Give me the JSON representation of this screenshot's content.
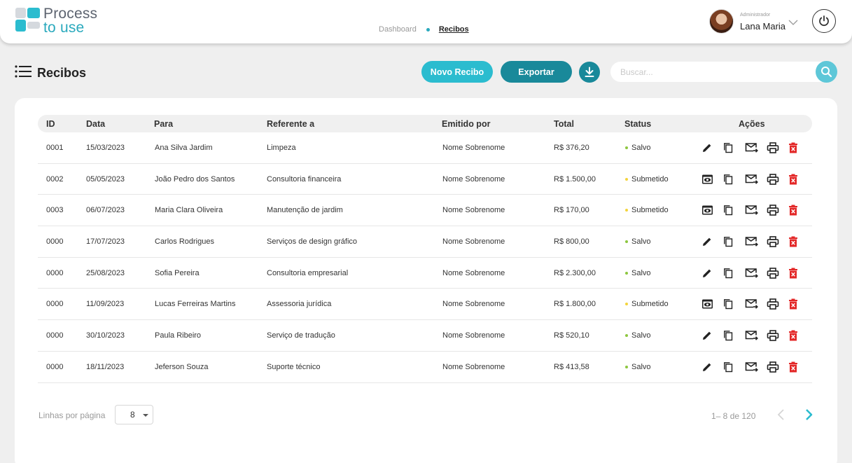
{
  "app": {
    "brand_line1": "Process",
    "brand_line2": "to use"
  },
  "breadcrumb": {
    "items": [
      "Dashboard",
      "Recibos"
    ]
  },
  "user": {
    "role": "Administrador",
    "name": "Lana Maria"
  },
  "page": {
    "title": "Recibos"
  },
  "toolbar": {
    "new_label": "Novo Recibo",
    "export_label": "Exportar",
    "search_placeholder": "Buscar..."
  },
  "colors": {
    "accent": "#2bbccf",
    "accent_dark": "#19899a",
    "status_saved": "#8dc63f",
    "status_submitted": "#f3d43c",
    "danger": "#e32727"
  },
  "table": {
    "headers": {
      "id": "ID",
      "date": "Data",
      "to": "Para",
      "ref": "Referente a",
      "issued_by": "Emitido por",
      "total": "Total",
      "status": "Status",
      "actions": "Ações"
    },
    "rows": [
      {
        "id": "0001",
        "date": "15/03/2023",
        "to": "Ana Silva Jardim",
        "ref": "Limpeza",
        "issued_by": "Nome Sobrenome",
        "total": "R$ 376,20",
        "status": "Salvo",
        "status_color": "#8dc63f",
        "primary_action": "edit-icon"
      },
      {
        "id": "0002",
        "date": "05/05/2023",
        "to": "João Pedro dos Santos",
        "ref": "Consultoria financeira",
        "issued_by": "Nome Sobrenome",
        "total": "R$ 1.500,00",
        "status": "Submetido",
        "status_color": "#f3d43c",
        "primary_action": "view-icon"
      },
      {
        "id": "0003",
        "date": "06/07/2023",
        "to": "Maria Clara Oliveira",
        "ref": "Manutenção de jardim",
        "issued_by": "Nome Sobrenome",
        "total": "R$ 170,00",
        "status": "Submetido",
        "status_color": "#f3d43c",
        "primary_action": "view-icon"
      },
      {
        "id": "0000",
        "date": "17/07/2023",
        "to": "Carlos Rodrigues",
        "ref": "Serviços de design gráfico",
        "issued_by": "Nome Sobrenome",
        "total": "R$ 800,00",
        "status": "Salvo",
        "status_color": "#8dc63f",
        "primary_action": "edit-icon"
      },
      {
        "id": "0000",
        "date": "25/08/2023",
        "to": "Sofia Pereira",
        "ref": "Consultoria empresarial",
        "issued_by": "Nome Sobrenome",
        "total": "R$ 2.300,00",
        "status": "Salvo",
        "status_color": "#8dc63f",
        "primary_action": "edit-icon"
      },
      {
        "id": "0000",
        "date": "11/09/2023",
        "to": "Lucas Ferreiras Martins",
        "ref": "Assessoria jurídica",
        "issued_by": "Nome Sobrenome",
        "total": "R$ 1.800,00",
        "status": "Submetido",
        "status_color": "#f3d43c",
        "primary_action": "view-icon"
      },
      {
        "id": "0000",
        "date": "30/10/2023",
        "to": "Paula Ribeiro",
        "ref": "Serviço de tradução",
        "issued_by": "Nome Sobrenome",
        "total": "R$ 520,10",
        "status": "Salvo",
        "status_color": "#8dc63f",
        "primary_action": "edit-icon"
      },
      {
        "id": "0000",
        "date": "18/11/2023",
        "to": "Jeferson Souza",
        "ref": "Suporte técnico",
        "issued_by": "Nome Sobrenome",
        "total": "R$ 413,58",
        "status": "Salvo",
        "status_color": "#8dc63f",
        "primary_action": "edit-icon"
      }
    ]
  },
  "pagination": {
    "rows_per_page_label": "Linhas por página",
    "rows_per_page_value": "8",
    "range_text": "1– 8 de 120"
  }
}
